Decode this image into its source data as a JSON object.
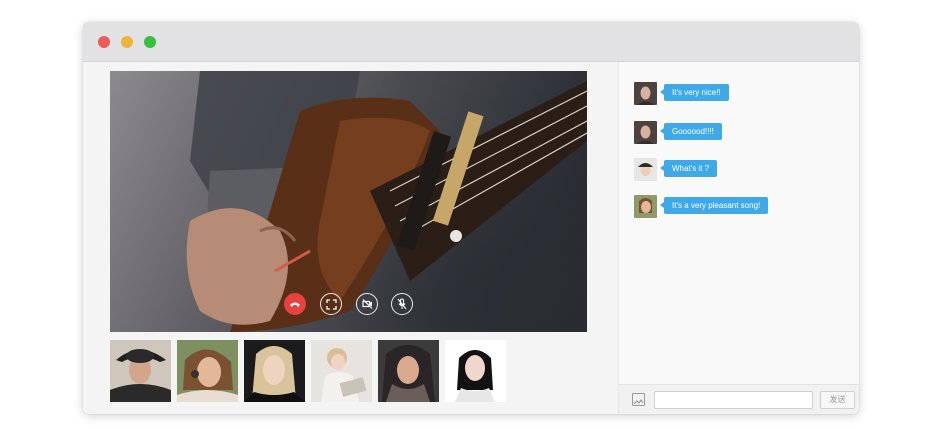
{
  "window": {
    "traffic_lights": [
      {
        "name": "close",
        "color": "#ec5b57"
      },
      {
        "name": "minimize",
        "color": "#f0b13d"
      },
      {
        "name": "zoom",
        "color": "#35c03f"
      }
    ]
  },
  "call": {
    "main_video": "guitar-player-video",
    "controls": [
      {
        "id": "hangup",
        "icon": "phone-hangup-icon",
        "color": "#e8413e"
      },
      {
        "id": "fullscreen",
        "icon": "fullscreen-icon"
      },
      {
        "id": "camera-off",
        "icon": "video-off-icon"
      },
      {
        "id": "mic-off",
        "icon": "mic-off-icon"
      }
    ],
    "participants": [
      {
        "id": "p1",
        "tone": "hat-woman"
      },
      {
        "id": "p2",
        "tone": "headphones-woman"
      },
      {
        "id": "p3",
        "tone": "blonde-woman"
      },
      {
        "id": "p4",
        "tone": "reading-woman"
      },
      {
        "id": "p5",
        "tone": "scarf-woman"
      },
      {
        "id": "p6",
        "tone": "dark-hair-woman"
      }
    ]
  },
  "chat": {
    "accent": "#3fa8e6",
    "messages": [
      {
        "text": "It's very nice!!"
      },
      {
        "text": "Goooood!!!!"
      },
      {
        "text": "What's it ?"
      },
      {
        "text": "It's a very pleasant song!"
      }
    ],
    "input": {
      "value": "",
      "placeholder": ""
    },
    "send_label": "发送"
  }
}
